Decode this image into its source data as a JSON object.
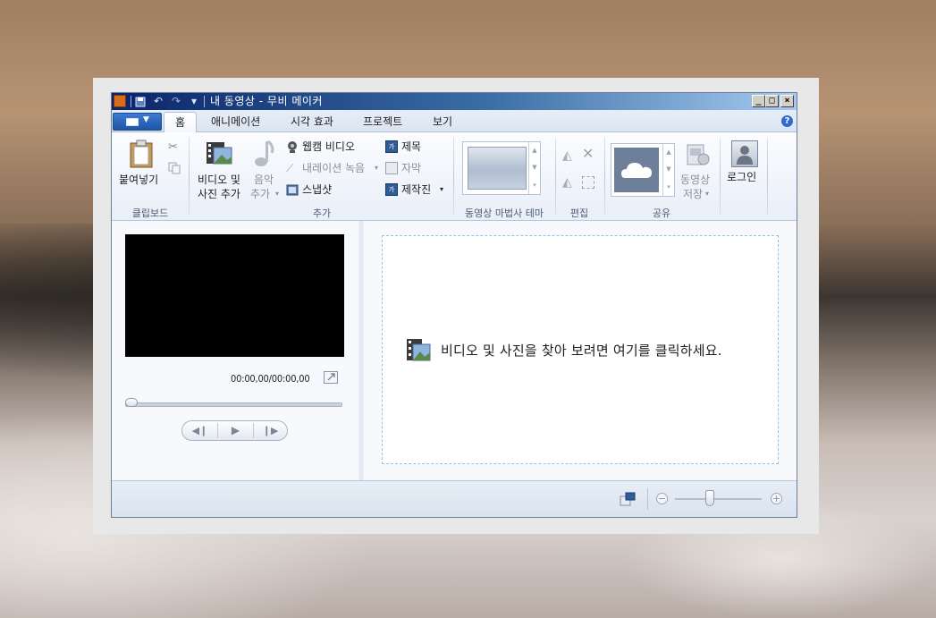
{
  "window": {
    "title": "내 동영상 - 무비 메이커",
    "controls": {
      "minimize": "_",
      "maximize": "□",
      "close": "×"
    }
  },
  "tabs": {
    "home": "홈",
    "animations": "애니메이션",
    "visual_effects": "시각 효과",
    "project": "프로젝트",
    "view": "보기"
  },
  "ribbon": {
    "clipboard": {
      "paste": "붙여넣기",
      "group": "클립보드"
    },
    "add": {
      "add_videos_line1": "비디오 및",
      "add_videos_line2": "사진 추가",
      "music_line1": "음악",
      "music_line2": "추가",
      "webcam": "웹캠 비디오",
      "narration": "내레이션 녹음",
      "snapshot": "스냅샷",
      "title": "제목",
      "caption": "자막",
      "credits": "제작진",
      "group": "추가"
    },
    "themes": {
      "group": "동영상 마법사 테마"
    },
    "editing": {
      "group": "편집"
    },
    "share": {
      "save_line1": "동영상",
      "save_line2": "저장",
      "group": "공유"
    },
    "signin": {
      "label": "로그인"
    }
  },
  "preview": {
    "timecode": "00:00,00/00:00,00",
    "playback_position": 0
  },
  "storyboard": {
    "hint": "비디오 및 사진을 찾아 보려면 여기를 클릭하세요."
  },
  "status": {
    "zoom_out": "−",
    "zoom_in": "+",
    "zoom_level": 0.4
  },
  "colors": {
    "title_bar_start": "#0a246a",
    "title_bar_end": "#a6caf0",
    "file_menu": "#1d55a8",
    "drop_zone_border": "#8fc3e8"
  },
  "icons": {
    "app": "movie-maker-icon",
    "save": "save-icon",
    "undo": "undo-icon",
    "redo": "redo-icon",
    "paste": "paste-icon",
    "cut": "cut-icon",
    "copy": "copy-icon",
    "add_videos": "film-photo-icon",
    "music": "music-note-icon",
    "webcam": "webcam-icon",
    "narration": "microphone-icon",
    "snapshot": "snapshot-icon",
    "title": "title-icon",
    "caption": "caption-icon",
    "credits": "credits-icon",
    "rotate_left": "rotate-left-icon",
    "rotate_right": "rotate-right-icon",
    "remove": "remove-icon",
    "select_all": "select-all-icon",
    "onedrive": "cloud-icon",
    "save_movie": "save-movie-icon",
    "signin": "person-icon",
    "help": "help-icon",
    "popout": "popout-icon",
    "prev_frame": "previous-frame-icon",
    "play": "play-icon",
    "next_frame": "next-frame-icon",
    "thumbnail_size": "thumbnail-size-icon"
  }
}
